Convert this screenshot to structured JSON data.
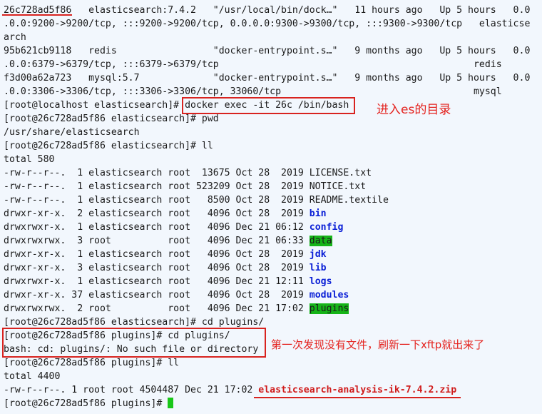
{
  "terminal": {
    "lines": [
      "26c728ad5f86   elasticsearch:7.4.2   \"/usr/local/bin/dock…\"   11 hours ago   Up 5 hours   0.0",
      ".0.0:9200->9200/tcp, :::9200->9200/tcp, 0.0.0.0:9300->9300/tcp, :::9300->9300/tcp   elasticse",
      "arch",
      "95b621cb9118   redis                 \"docker-entrypoint.s…\"   9 months ago   Up 5 hours   0.0",
      ".0.0:6379->6379/tcp, :::6379->6379/tcp                                             redis",
      "f3d00a62a723   mysql:5.7             \"docker-entrypoint.s…\"   9 months ago   Up 5 hours   0.0",
      ".0.0:3306->3306/tcp, :::3306->3306/tcp, 33060/tcp                                  mysql",
      "[root@localhost elasticsearch]# docker exec -it 26c /bin/bash",
      "[root@26c728ad5f86 elasticsearch]# pwd",
      "/usr/share/elasticsearch",
      "[root@26c728ad5f86 elasticsearch]# ll",
      "total 580",
      "-rw-r--r--.  1 elasticsearch root  13675 Oct 28  2019 LICENSE.txt",
      "-rw-r--r--.  1 elasticsearch root 523209 Oct 28  2019 NOTICE.txt",
      "-rw-r--r--.  1 elasticsearch root   8500 Oct 28  2019 README.textile",
      "drwxr-xr-x.  2 elasticsearch root   4096 Oct 28  2019 ",
      "drwxrwxr-x.  1 elasticsearch root   4096 Dec 21 06:12 ",
      "drwxrwxrwx.  3 root          root   4096 Dec 21 06:33 ",
      "drwxr-xr-x.  1 elasticsearch root   4096 Oct 28  2019 ",
      "drwxr-xr-x.  3 elasticsearch root   4096 Oct 28  2019 ",
      "drwxrwxr-x.  1 elasticsearch root   4096 Dec 21 12:11 ",
      "drwxr-xr-x. 37 elasticsearch root   4096 Oct 28  2019 ",
      "drwxrwxrwx.  2 root          root   4096 Dec 21 17:02 ",
      "[root@26c728ad5f86 elasticsearch]# cd plugins/",
      "[root@26c728ad5f86 plugins]# cd plugins/",
      "bash: cd: plugins/: No such file or directory",
      "[root@26c728ad5f86 plugins]# ll",
      "total 4400",
      "-rw-r--r--. 1 root root 4504487 Dec 21 17:02 ",
      "[root@26c728ad5f86 plugins]# "
    ],
    "dir_names": {
      "bin": "bin",
      "config": "config",
      "data": "data",
      "jdk": "jdk",
      "lib": "lib",
      "logs": "logs",
      "modules": "modules",
      "plugins": "plugins"
    },
    "zip_file": "elasticsearch-analysis-ik-7.4.2.zip"
  },
  "annotations": {
    "enter_es": "进入es的目录",
    "refresh_note": "第一次发现没有文件，刷新一下xftp就出来了"
  },
  "colors": {
    "background": "#f2f7fd",
    "dir_blue": "#0a1fd6",
    "dir_highlight_green": "#16b418",
    "annotation_red": "#e4231f",
    "cursor_green": "#19c719"
  }
}
